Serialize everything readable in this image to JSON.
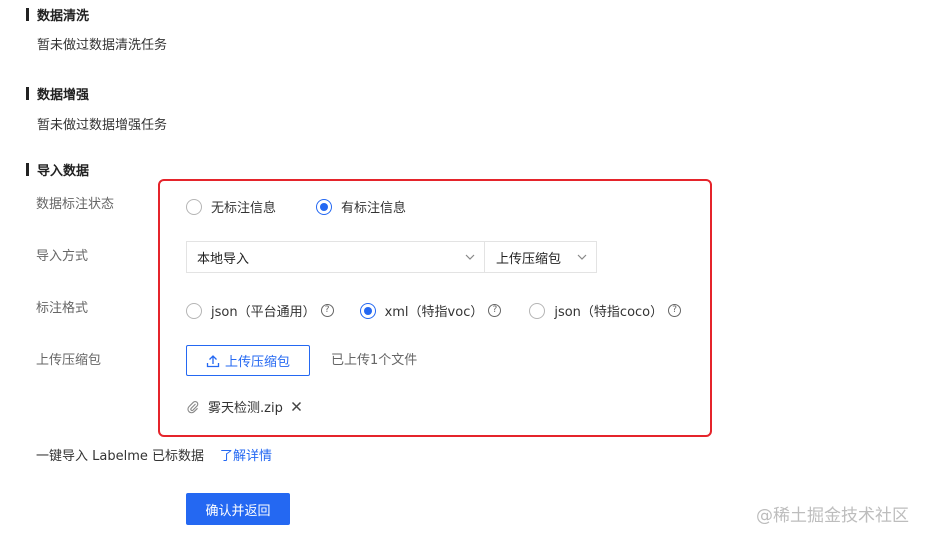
{
  "sections": {
    "cleaning": {
      "title": "数据清洗",
      "text": "暂未做过数据清洗任务"
    },
    "augmentation": {
      "title": "数据增强",
      "text": "暂未做过数据增强任务"
    },
    "import": {
      "title": "导入数据"
    }
  },
  "form": {
    "annotation_status": {
      "label": "数据标注状态",
      "options": [
        "无标注信息",
        "有标注信息"
      ],
      "selected": "有标注信息"
    },
    "import_method": {
      "label": "导入方式",
      "source_value": "本地导入",
      "type_value": "上传压缩包"
    },
    "annotation_format": {
      "label": "标注格式",
      "options": [
        "json（平台通用）",
        "xml（特指voc）",
        "json（特指coco）"
      ],
      "selected": "xml（特指voc）",
      "help_glyph": "?"
    },
    "upload": {
      "label": "上传压缩包",
      "button_label": "上传压缩包",
      "status_text": "已上传1个文件",
      "file_name": "雾天检测.zip"
    }
  },
  "bottom": {
    "labelme_text": "一键导入 Labelme 已标数据",
    "details_link": "了解详情",
    "confirm_button": "确认并返回"
  },
  "watermark": "@稀土掘金技术社区",
  "colors": {
    "accent": "#2468f2",
    "highlight_border": "#e5242b"
  },
  "icons": {
    "upload": "upload-icon",
    "attachment": "paperclip-icon",
    "remove": "close-icon",
    "dropdown": "chevron-down-icon",
    "help": "help-circle-icon"
  }
}
